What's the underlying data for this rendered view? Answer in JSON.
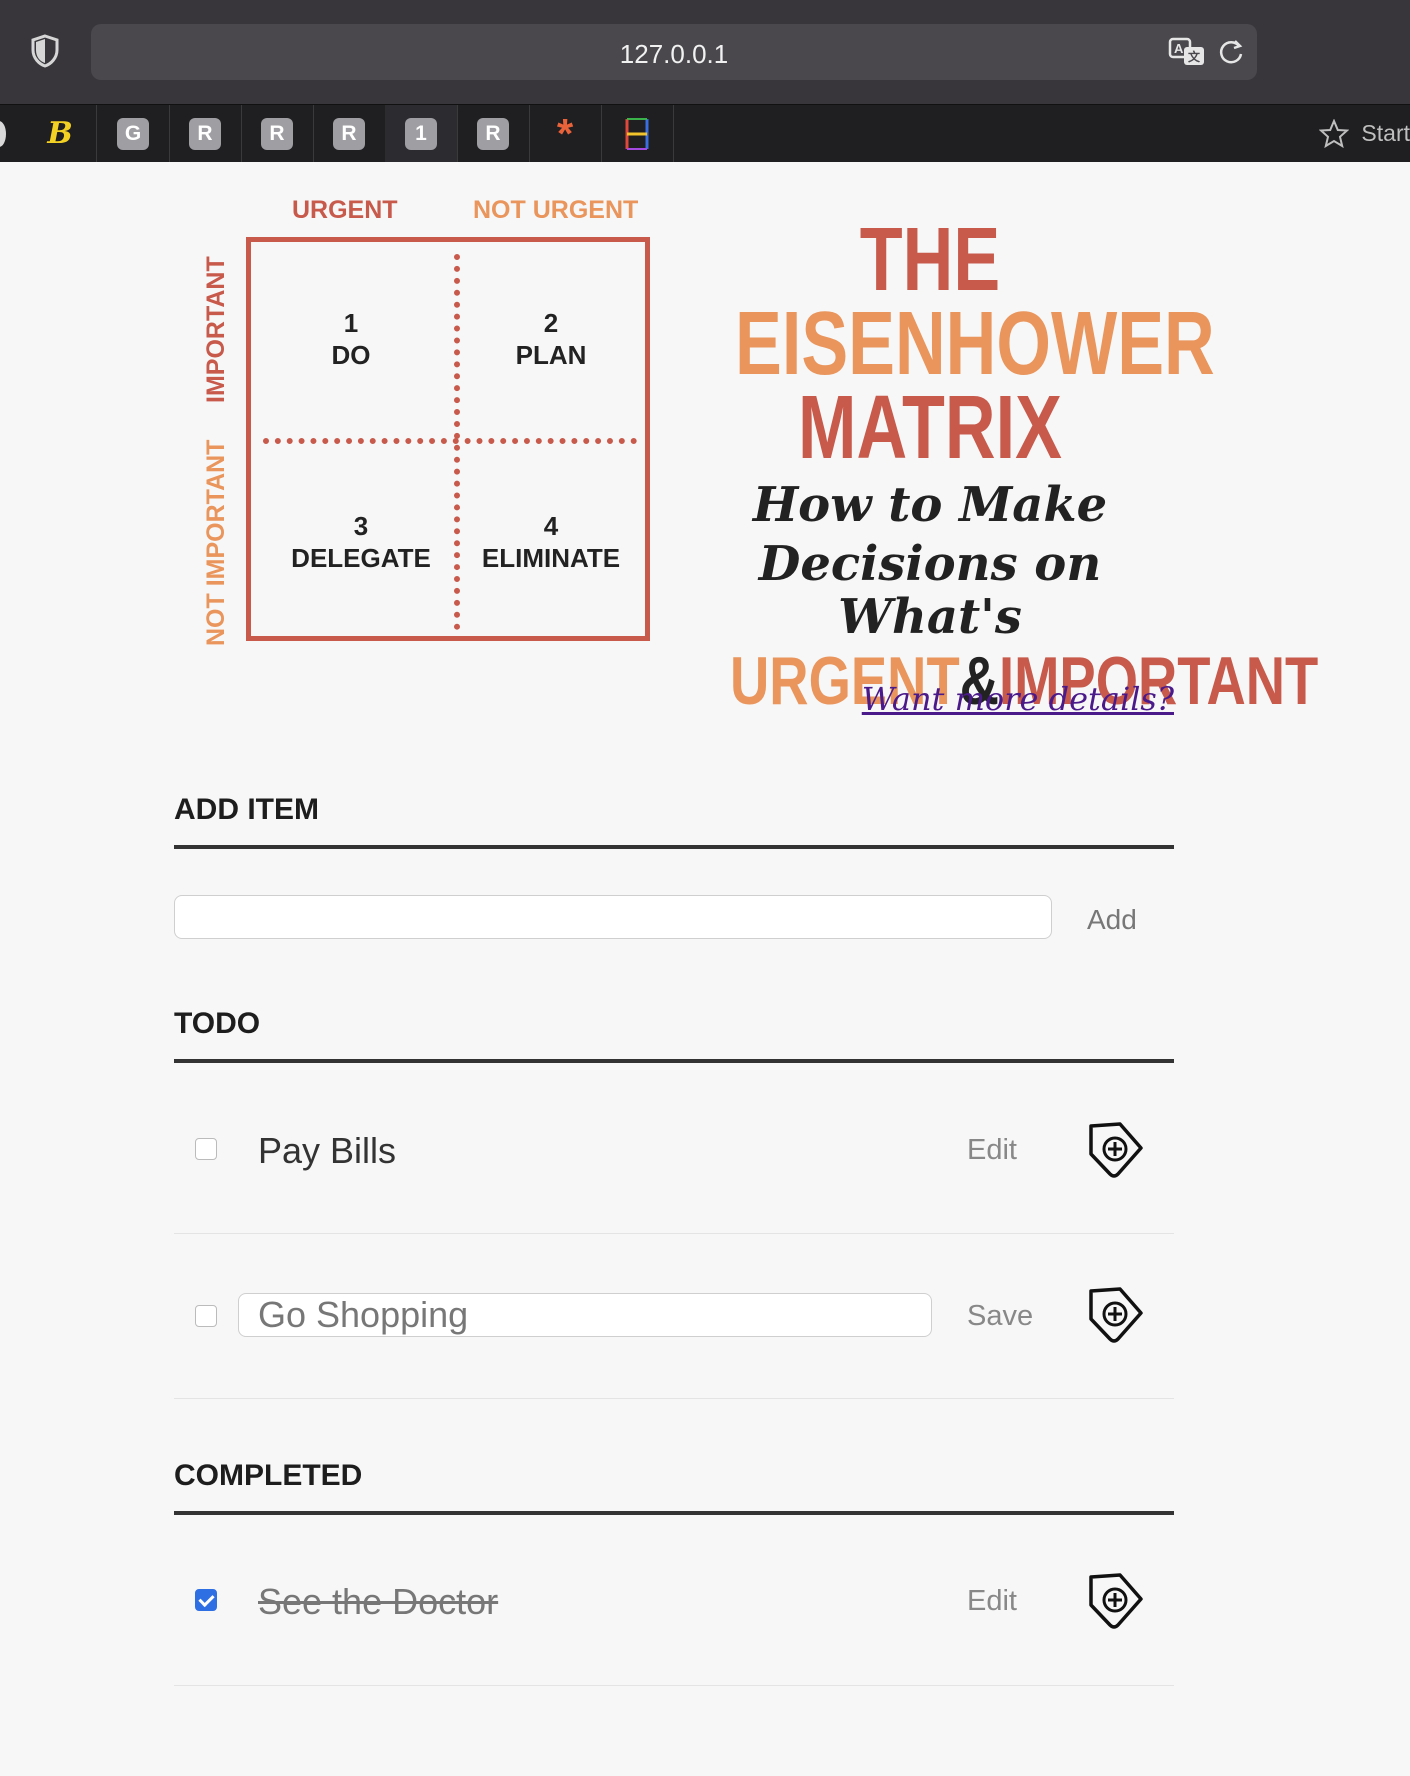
{
  "browser": {
    "url": "127.0.0.1",
    "bookmarks": [
      "B",
      "G",
      "R",
      "R",
      "R",
      "1",
      "R",
      "*",
      ""
    ],
    "start_label": "Start"
  },
  "matrix": {
    "col_urgent": "URGENT",
    "col_not_urgent": "NOT URGENT",
    "row_important": "IMPORTANT",
    "row_not_important": "NOT IMPORTANT",
    "q1_num": "1",
    "q1_label": "DO",
    "q2_num": "2",
    "q2_label": "PLAN",
    "q3_num": "3",
    "q3_label": "DELEGATE",
    "q4_num": "4",
    "q4_label": "ELIMINATE",
    "colors": {
      "red": "#c85a4c",
      "orange": "#e9955c"
    }
  },
  "title_art": {
    "line1": "THE",
    "line2": "EISENHOWER",
    "line3": "MATRIX",
    "line4": "How to Make",
    "line5": "Decisions on What's",
    "urgent": "URGENT",
    "amp": "&",
    "important": "IMPORTANT"
  },
  "details_link": "Want more details?",
  "add_item": {
    "heading": "ADD ITEM",
    "input_value": "",
    "button_label": "Add"
  },
  "todo": {
    "heading": "TODO",
    "items": [
      {
        "text": "Pay Bills",
        "checked": false,
        "action": "Edit",
        "editing": false
      },
      {
        "text": "Go Shopping",
        "checked": false,
        "action": "Save",
        "editing": true
      }
    ]
  },
  "completed": {
    "heading": "COMPLETED",
    "items": [
      {
        "text": "See the Doctor",
        "checked": true,
        "action": "Edit",
        "editing": false
      }
    ]
  }
}
